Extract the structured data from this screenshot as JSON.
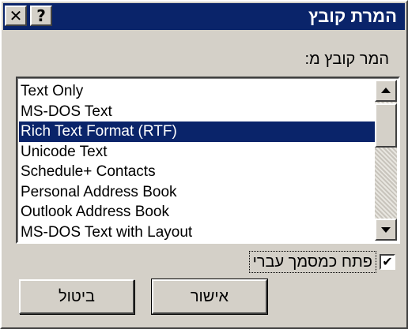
{
  "window": {
    "title": "המרת קובץ",
    "close_symbol": "✕",
    "help_symbol": "?"
  },
  "list": {
    "label": "המר קובץ מ:",
    "items": [
      "Text Only",
      "MS-DOS Text",
      "Rich Text Format (RTF)",
      "Unicode Text",
      "Schedule+ Contacts",
      "Personal Address Book",
      "Outlook Address Book",
      "MS-DOS Text with Layout"
    ],
    "selected_index": 2
  },
  "checkbox": {
    "label": "פתח כמסמך עברי",
    "checked": true,
    "check_symbol": "✔"
  },
  "buttons": {
    "ok": "אישור",
    "cancel": "ביטול"
  },
  "icons": {
    "close": "close-icon",
    "help": "help-icon",
    "scroll_up": "arrow-up-icon",
    "scroll_down": "arrow-down-icon"
  },
  "colors": {
    "titlebar": "#0a246a",
    "selection": "#0a246a",
    "face": "#d4d0c8"
  }
}
